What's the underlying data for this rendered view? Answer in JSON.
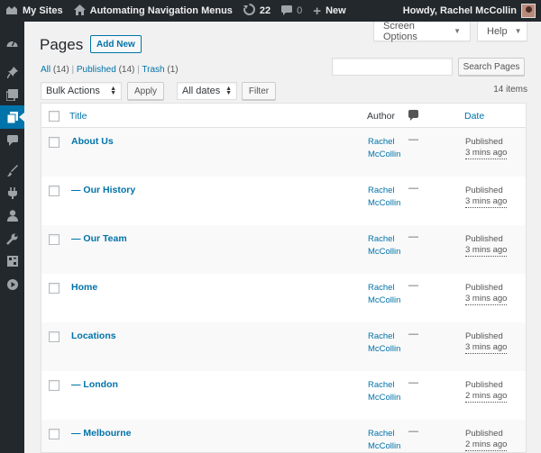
{
  "adminbar": {
    "my_sites": "My Sites",
    "site_name": "Automating Navigation Menus",
    "updates_count": "22",
    "comments_count": "0",
    "new_label": "New",
    "greeting": "Howdy, Rachel McCollin"
  },
  "screen_options": {
    "screen_options_label": "Screen Options",
    "help_label": "Help"
  },
  "header": {
    "title": "Pages",
    "add_new_label": "Add New"
  },
  "filters": {
    "all_label": "All",
    "all_count": "(14)",
    "published_label": "Published",
    "published_count": "(14)",
    "trash_label": "Trash",
    "trash_count": "(1)"
  },
  "search": {
    "button_label": "Search Pages",
    "value": ""
  },
  "actions": {
    "bulk_selected": "Bulk Actions",
    "apply_label": "Apply",
    "dates_selected": "All dates",
    "filter_label": "Filter",
    "items_count": "14 items"
  },
  "table": {
    "headers": {
      "title": "Title",
      "author": "Author",
      "date": "Date"
    },
    "rows": [
      {
        "title": "About Us",
        "author": "Rachel McCollin",
        "comments": "—",
        "status": "Published",
        "time": "3 mins ago"
      },
      {
        "title": "— Our History",
        "author": "Rachel McCollin",
        "comments": "—",
        "status": "Published",
        "time": "3 mins ago"
      },
      {
        "title": "— Our Team",
        "author": "Rachel McCollin",
        "comments": "—",
        "status": "Published",
        "time": "3 mins ago"
      },
      {
        "title": "Home",
        "author": "Rachel McCollin",
        "comments": "—",
        "status": "Published",
        "time": "3 mins ago"
      },
      {
        "title": "Locations",
        "author": "Rachel McCollin",
        "comments": "—",
        "status": "Published",
        "time": "3 mins ago"
      },
      {
        "title": "— London",
        "author": "Rachel McCollin",
        "comments": "—",
        "status": "Published",
        "time": "2 mins ago"
      },
      {
        "title": "— Melbourne",
        "author": "Rachel McCollin",
        "comments": "—",
        "status": "Published",
        "time": "2 mins ago"
      }
    ]
  },
  "sidebar": {
    "icons": [
      "dashboard-icon",
      "posts-pin-icon",
      "media-icon",
      "pages-icon",
      "comments-icon",
      "appearance-brush-icon",
      "plugins-icon",
      "users-icon",
      "tools-wrench-icon",
      "settings-icon",
      "media-play-icon"
    ]
  },
  "colors": {
    "accent": "#0073aa",
    "adminbar": "#23282d",
    "background": "#f1f1f1"
  }
}
